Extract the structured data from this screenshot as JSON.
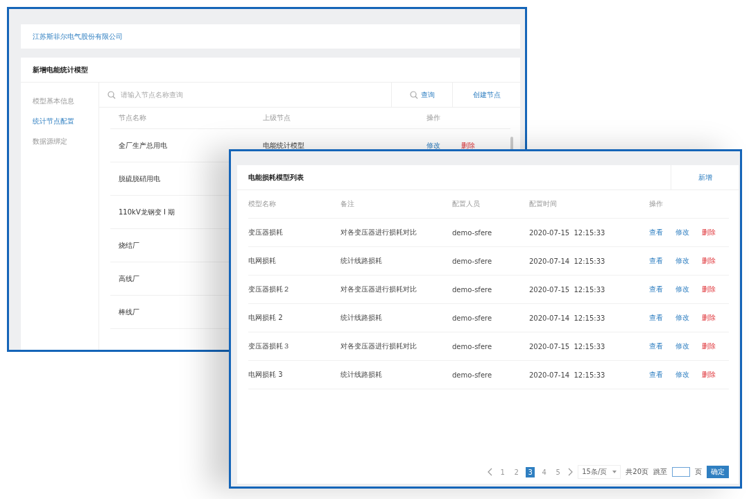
{
  "back_window": {
    "company": "江苏斯菲尔电气股份有限公司",
    "title": "新增电能统计模型",
    "sidebar": [
      {
        "label": "模型基本信息",
        "selected": false
      },
      {
        "label": "统计节点配置",
        "selected": true
      },
      {
        "label": "数据源绑定",
        "selected": false
      }
    ],
    "search": {
      "placeholder": "请输入节点名称查询"
    },
    "query_button": "查询",
    "create_button": "创建节点",
    "columns": [
      "节点名称",
      "上级节点",
      "操作"
    ],
    "rows": [
      {
        "name": "全厂生产总用电",
        "parent": "电能统计模型",
        "edit": "修改",
        "delete": "删除"
      },
      {
        "name": "脱硫脱硝用电"
      },
      {
        "name": "110kV龙钢变 I 期"
      },
      {
        "name": "烧结厂"
      },
      {
        "name": "高线厂"
      },
      {
        "name": "棒线厂"
      }
    ]
  },
  "front_window": {
    "title": "电能损耗模型列表",
    "add_button": "新增",
    "columns": [
      "模型名称",
      "备注",
      "配置人员",
      "配置时间",
      "操作"
    ],
    "rows": [
      {
        "name": "变压器损耗",
        "note": "对各变压器进行损耗对比",
        "user": "demo-sfere",
        "time": "2020-07-15  12:15:33",
        "view": "查看",
        "edit": "修改",
        "delete": "删除"
      },
      {
        "name": "电网损耗",
        "note": "统计线路损耗",
        "user": "demo-sfere",
        "time": "2020-07-14  12:15:33",
        "view": "查看",
        "edit": "修改",
        "delete": "删除"
      },
      {
        "name": "变压器损耗２",
        "note": "对各变压器进行损耗对比",
        "user": "demo-sfere",
        "time": "2020-07-15  12:15:33",
        "view": "查看",
        "edit": "修改",
        "delete": "删除"
      },
      {
        "name": "电网损耗 2",
        "note": "统计线路损耗",
        "user": "demo-sfere",
        "time": "2020-07-14  12:15:33",
        "view": "查看",
        "edit": "修改",
        "delete": "删除"
      },
      {
        "name": "变压器损耗３",
        "note": "对各变压器进行损耗对比",
        "user": "demo-sfere",
        "time": "2020-07-15  12:15:33",
        "view": "查看",
        "edit": "修改",
        "delete": "删除"
      },
      {
        "name": "电网损耗 3",
        "note": "统计线路损耗",
        "user": "demo-sfere",
        "time": "2020-07-14  12:15:33",
        "view": "查看",
        "edit": "修改",
        "delete": "删除"
      }
    ],
    "pagination": {
      "pages": [
        {
          "label": "1",
          "selected": false
        },
        {
          "label": "2",
          "selected": false
        },
        {
          "label": "3",
          "selected": true
        },
        {
          "label": "4",
          "selected": false
        },
        {
          "label": "5",
          "selected": false
        }
      ],
      "page_size": "15条/页",
      "total": "共20页",
      "jump_label": "跳至",
      "unit": "页",
      "confirm": "确定"
    }
  }
}
